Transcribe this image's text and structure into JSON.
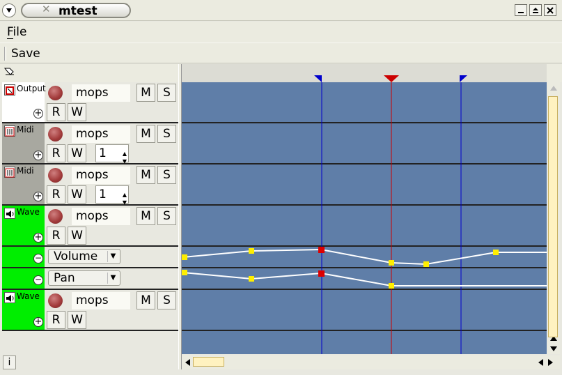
{
  "window": {
    "title": "mtest"
  },
  "menu": {
    "file": "File"
  },
  "toolbar": {
    "save": "Save"
  },
  "info_button": "i",
  "tracks": [
    {
      "type": "Output",
      "name": "mops",
      "m": "M",
      "s": "S",
      "r": "R",
      "w": "W",
      "label_color": "#ffffff"
    },
    {
      "type": "Midi",
      "name": "mops",
      "m": "M",
      "s": "S",
      "r": "R",
      "w": "W",
      "channel": "1",
      "label_color": "#a8a8a0"
    },
    {
      "type": "Midi",
      "name": "mops",
      "m": "M",
      "s": "S",
      "r": "R",
      "w": "W",
      "channel": "1",
      "label_color": "#a8a8a0"
    },
    {
      "type": "Wave",
      "name": "mops",
      "m": "M",
      "s": "S",
      "r": "R",
      "w": "W",
      "label_color": "#00ee00"
    },
    {
      "type": "Wave",
      "name": "mops",
      "m": "M",
      "s": "S",
      "r": "R",
      "w": "W",
      "label_color": "#00ee00"
    }
  ],
  "automation": {
    "volume": "Volume",
    "pan": "Pan"
  },
  "colors": {
    "canvas": "#5f7ea8",
    "marker_blue": "#0000cc",
    "marker_red": "#cc0000",
    "point": "#ffee00",
    "point_active": "#dd0000"
  }
}
